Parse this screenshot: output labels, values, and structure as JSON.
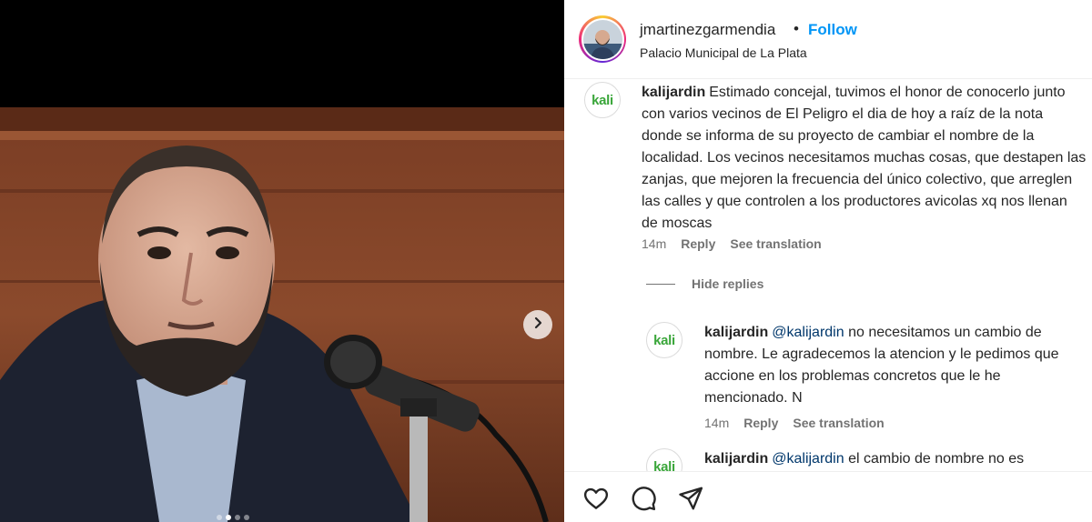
{
  "post": {
    "username": "jmartinezgarmendia",
    "separator": "•",
    "follow_label": "Follow",
    "location": "Palacio Municipal de La Plata"
  },
  "comments": [
    {
      "user": "kalijardin",
      "avatar_text": "kali",
      "text": "Estimado concejal, tuvimos el honor de conocerlo junto con varios vecinos de El Peligro el dia de hoy a raíz de la nota donde se informa de su proyecto de cambiar el nombre de la localidad. Los vecinos necesitamos muchas cosas, que destapen las zanjas, que mejoren la frecuencia del único colectivo, que arreglen las calles y que controlen a los productores avicolas xq nos llenan de moscas",
      "time": "14m",
      "reply_label": "Reply",
      "translate_label": "See translation"
    }
  ],
  "hide_replies_label": "Hide replies",
  "replies": [
    {
      "user": "kalijardin",
      "avatar_text": "kali",
      "mention": "@kalijardin",
      "text": "no necesitamos un cambio de nombre. Le agradecemos la atencion y le pedimos que accione en los problemas concretos que le he mencionado. N",
      "time": "14m",
      "reply_label": "Reply",
      "translate_label": "See translation"
    },
    {
      "user": "kalijardin",
      "avatar_text": "kali",
      "mention": "@kalijardin",
      "text": "el cambio de nombre no es"
    }
  ],
  "carousel": {
    "count": 4,
    "active": 1
  },
  "icons": [
    "heart-icon",
    "comment-icon",
    "share-icon",
    "chevron-right-icon"
  ],
  "colors": {
    "follow": "#0095f6",
    "mention": "#00376b",
    "meta": "#737373",
    "kali_green": "#3aa63a"
  }
}
